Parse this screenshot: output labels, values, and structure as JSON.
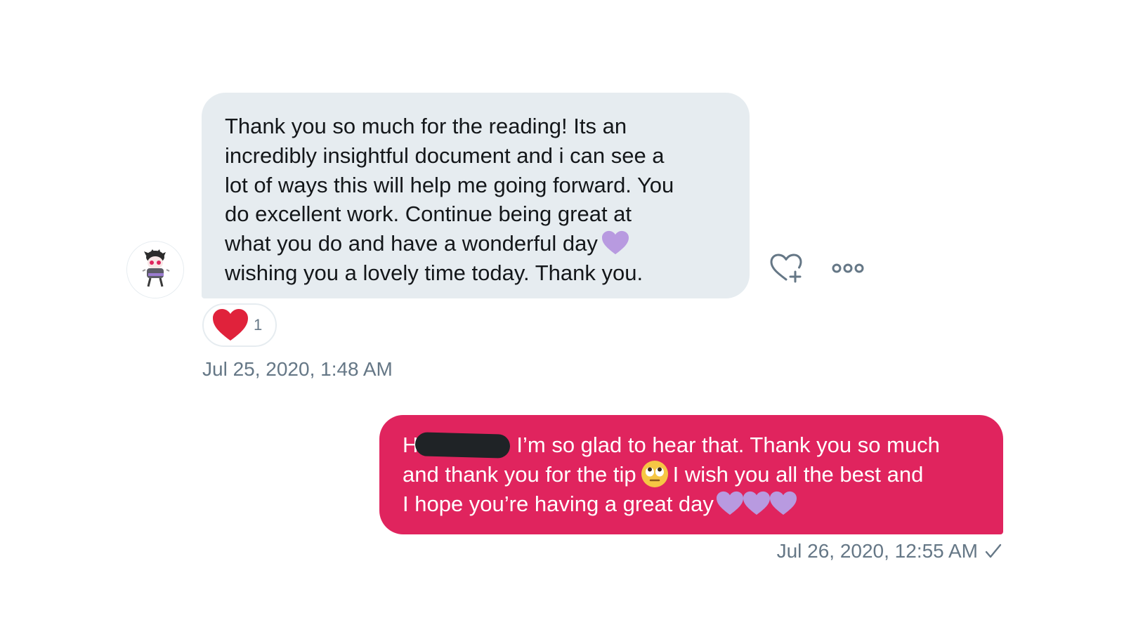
{
  "received": {
    "avatar_icon": "user-avatar-cartoon",
    "lines": [
      "Thank you so much for the reading! Its an",
      "incredibly insightful document and i can see a",
      "lot of ways this will help me going forward. You",
      "do excellent work. Continue being great at",
      "what you do and have a wonderful day",
      "wishing you a lovely time today. Thank you."
    ],
    "inline_emoji": "purple-heart",
    "reaction": {
      "emoji": "red-heart",
      "count": "1"
    },
    "timestamp": "Jul 25, 2020, 1:48 AM",
    "actions": {
      "react_icon": "heart-add-icon",
      "more_icon": "more-options-icon"
    },
    "bubble_color": "#e6ecf0"
  },
  "sent": {
    "lines": [
      "H",
      "I’m so glad to hear that. Thank you so much",
      "and thank you for the tip",
      "I wish you all the best and",
      "I hope you’re having a great day"
    ],
    "redacted_name": true,
    "inline_emoji_face": "rolling-eyes-face",
    "trailing_emojis": [
      "purple-heart",
      "purple-heart",
      "purple-heart"
    ],
    "timestamp": "Jul 26, 2020, 12:55 AM",
    "status_icon": "checkmark-icon",
    "bubble_color": "#e0245e"
  },
  "colors": {
    "accent_pink": "#e0245e",
    "received_bubble": "#e6ecf0",
    "timestamp_gray": "#657786",
    "purple_heart": "#b89ae0",
    "red_heart": "#e0223b"
  }
}
